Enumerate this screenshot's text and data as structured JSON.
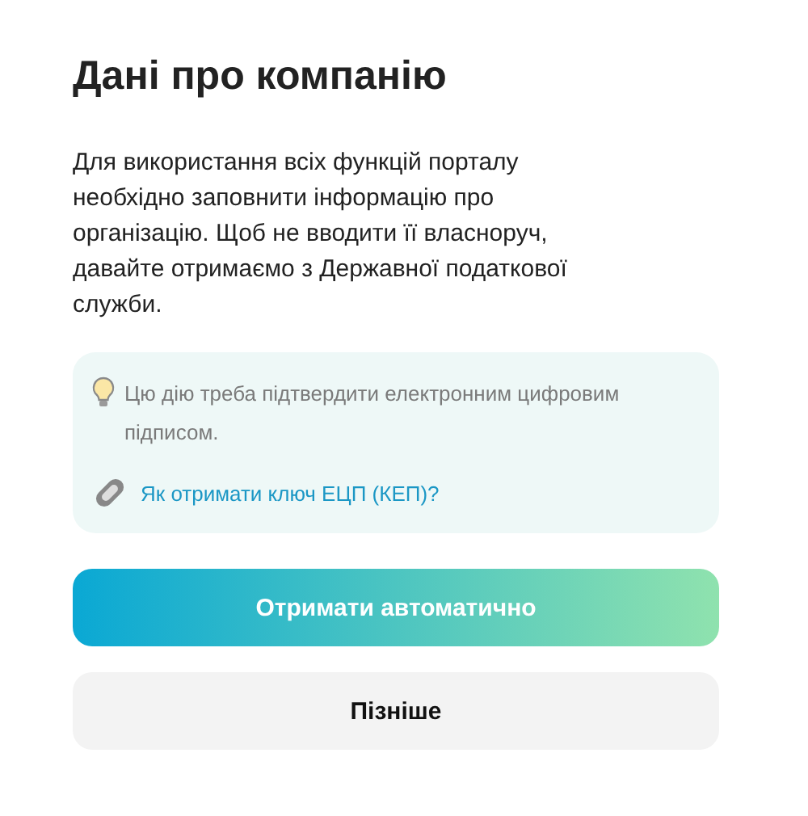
{
  "title": "Дані про компанію",
  "description": "Для використання всіх функцій порталу необхідно заповнити інформацію про організацію. Щоб не вводити її власноруч, давайте отримаємо з Державної податкової служби.",
  "notice": {
    "text": "Цю дію треба підтвердити електронним цифровим підписом.",
    "link": "Як отримати ключ ЕЦП (КЕП)?"
  },
  "buttons": [
    {
      "label": "Отримати автоматично",
      "kind": "primary"
    },
    {
      "label": "Пізніше",
      "kind": "secondary"
    }
  ]
}
